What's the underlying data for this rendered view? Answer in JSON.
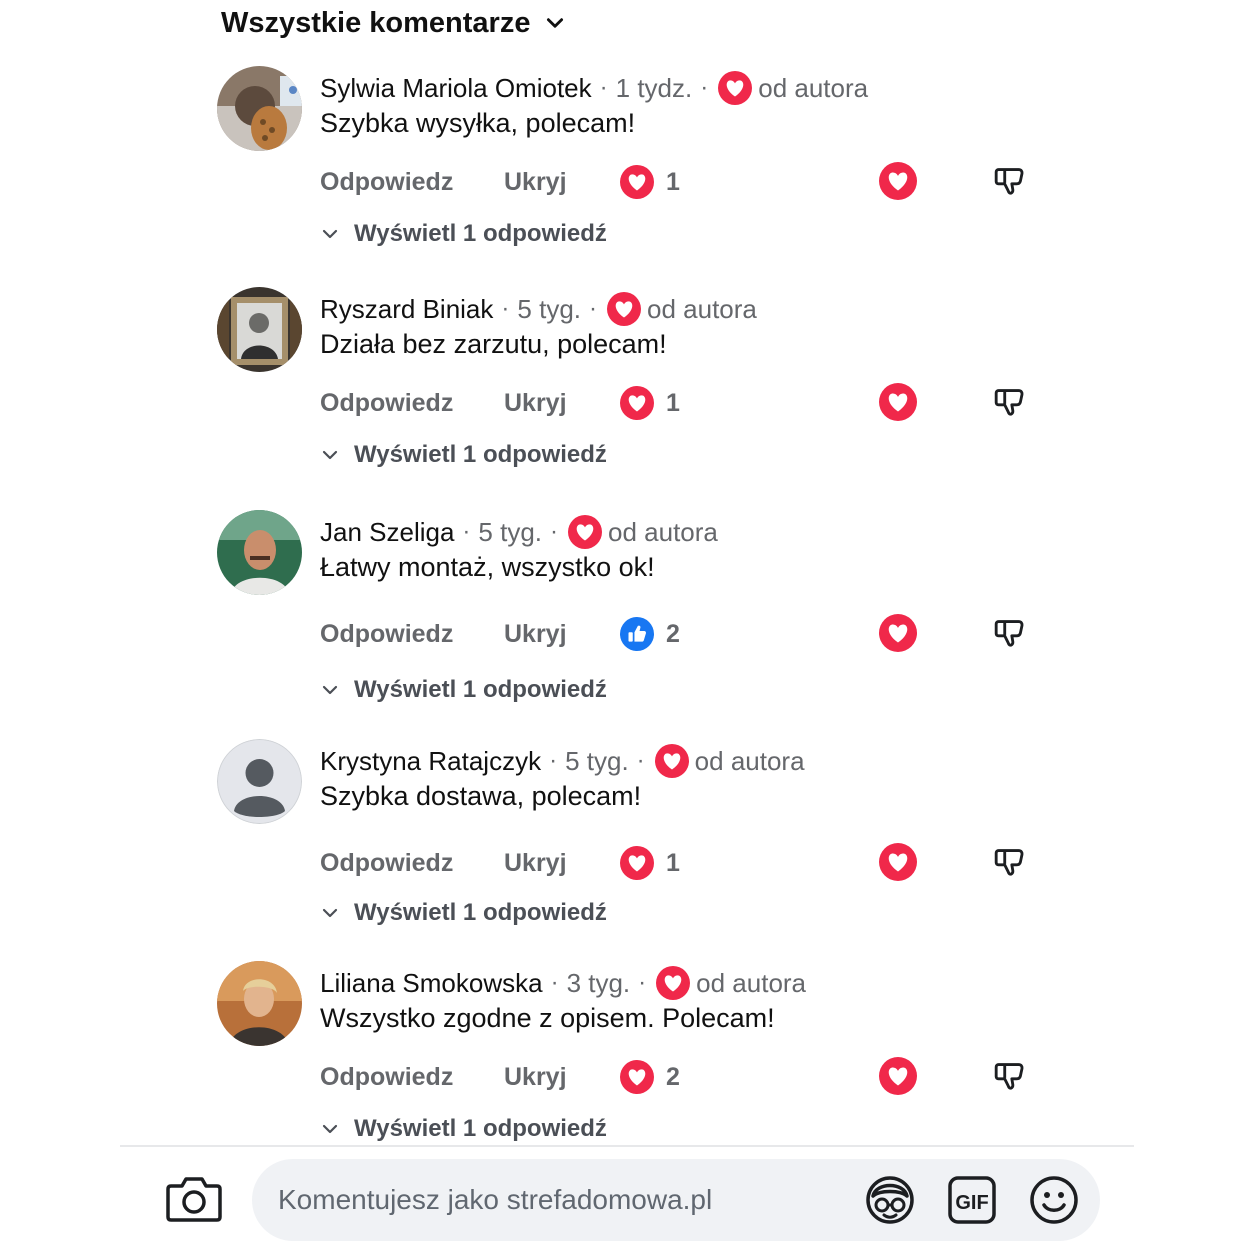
{
  "header": {
    "title": "Wszystkie komentarze"
  },
  "labels": {
    "reply": "Odpowiedz",
    "hide": "Ukryj",
    "from_author": "od autora",
    "view_replies": "Wyświetl 1 odpowiedź"
  },
  "comments": [
    {
      "name": "Sylwia Mariola Omiotek",
      "time": "1 tydz.",
      "text": "Szybka wysyłka, polecam!",
      "reaction": "heart",
      "count": "1"
    },
    {
      "name": "Ryszard Biniak",
      "time": "5 tyg.",
      "text": "Działa bez zarzutu, polecam!",
      "reaction": "heart",
      "count": "1"
    },
    {
      "name": "Jan Szeliga",
      "time": "5 tyg.",
      "text": "Łatwy montaż, wszystko ok!",
      "reaction": "like",
      "count": "2"
    },
    {
      "name": "Krystyna Ratajczyk",
      "time": "5 tyg.",
      "text": "Szybka dostawa, polecam!",
      "reaction": "heart",
      "count": "1"
    },
    {
      "name": "Liliana Smokowska",
      "time": "3 tyg.",
      "text": "Wszystko zgodne z opisem. Polecam!",
      "reaction": "heart",
      "count": "2"
    }
  ],
  "composer": {
    "placeholder": "Komentujesz jako strefadomowa.pl",
    "icons": [
      "camera-icon",
      "avatar-sticker-icon",
      "gif-icon",
      "emoji-icon"
    ]
  },
  "colors": {
    "heart": "#f0284a",
    "like": "#1877f2",
    "muted": "#65676b"
  }
}
